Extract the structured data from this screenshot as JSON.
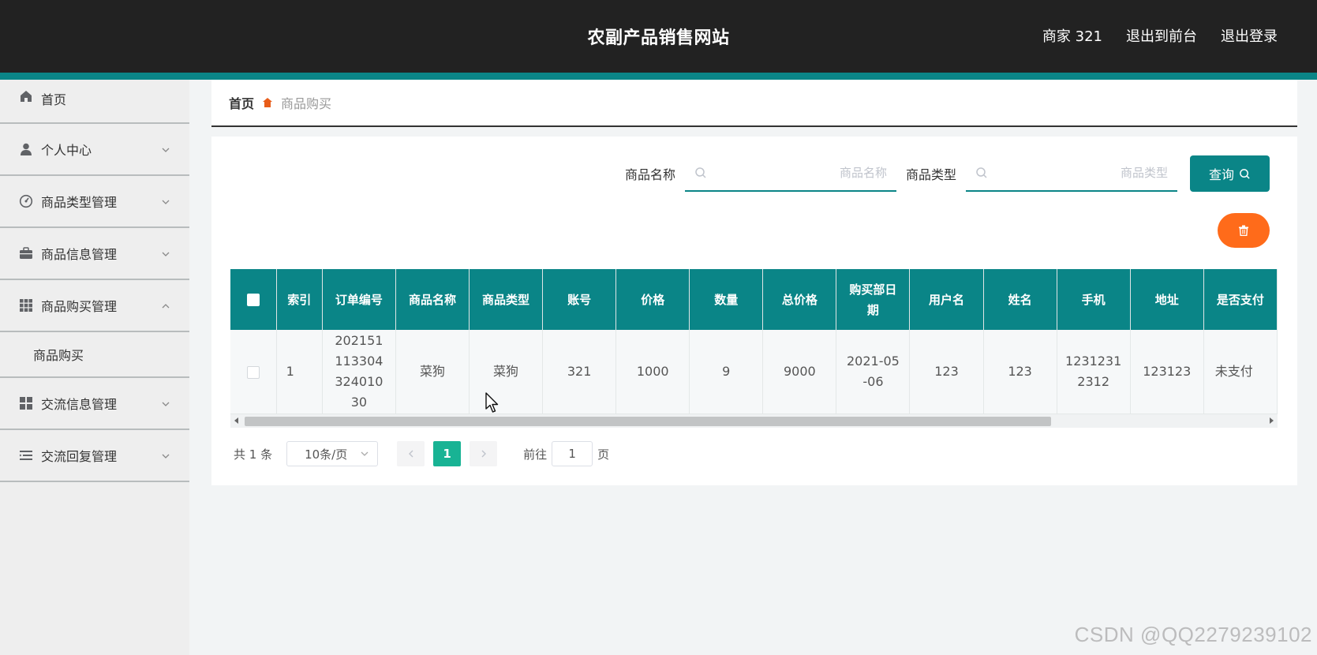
{
  "header": {
    "title": "农副产品销售网站",
    "user_label": "商家 321",
    "back_to_front": "退出到前台",
    "logout": "退出登录"
  },
  "sidebar": {
    "items": [
      {
        "label": "首页",
        "icon": "home-icon"
      },
      {
        "label": "个人中心",
        "icon": "user-icon"
      },
      {
        "label": "商品类型管理",
        "icon": "dashboard-icon"
      },
      {
        "label": "商品信息管理",
        "icon": "briefcase-icon"
      },
      {
        "label": "商品购买管理",
        "icon": "grid-icon",
        "expanded": true,
        "children": [
          {
            "label": "商品购买"
          }
        ]
      },
      {
        "label": "交流信息管理",
        "icon": "apps-icon"
      },
      {
        "label": "交流回复管理",
        "icon": "list-icon"
      }
    ]
  },
  "breadcrumb": {
    "home": "首页",
    "current": "商品购买"
  },
  "search": {
    "name_label": "商品名称",
    "name_placeholder": "商品名称",
    "type_label": "商品类型",
    "type_placeholder": "商品类型",
    "query_label": "查询"
  },
  "table": {
    "columns": [
      "索引",
      "订单编号",
      "商品名称",
      "商品类型",
      "账号",
      "价格",
      "数量",
      "总价格",
      "购买部日期",
      "用户名",
      "姓名",
      "手机",
      "地址",
      "是否支付"
    ],
    "rows": [
      {
        "index": "1",
        "order_no": "20215111330432401030",
        "product_name": "菜狗",
        "product_type": "菜狗",
        "account": "321",
        "price": "1000",
        "quantity": "9",
        "total": "9000",
        "date": "2021-05-06",
        "username": "123",
        "name": "123",
        "phone": "12312312312",
        "address": "123123",
        "paid": "未支付"
      }
    ]
  },
  "pagination": {
    "total": "共 1 条",
    "page_size": "10条/页",
    "current_page": "1",
    "goto_label": "前往",
    "goto_value": "1",
    "page_suffix": "页"
  },
  "watermark": "CSDN @QQ2279239102",
  "colors": {
    "accent": "#0a8587",
    "header_bg": "#222222",
    "delete": "#ff6b1a",
    "page_active": "#18b394"
  }
}
